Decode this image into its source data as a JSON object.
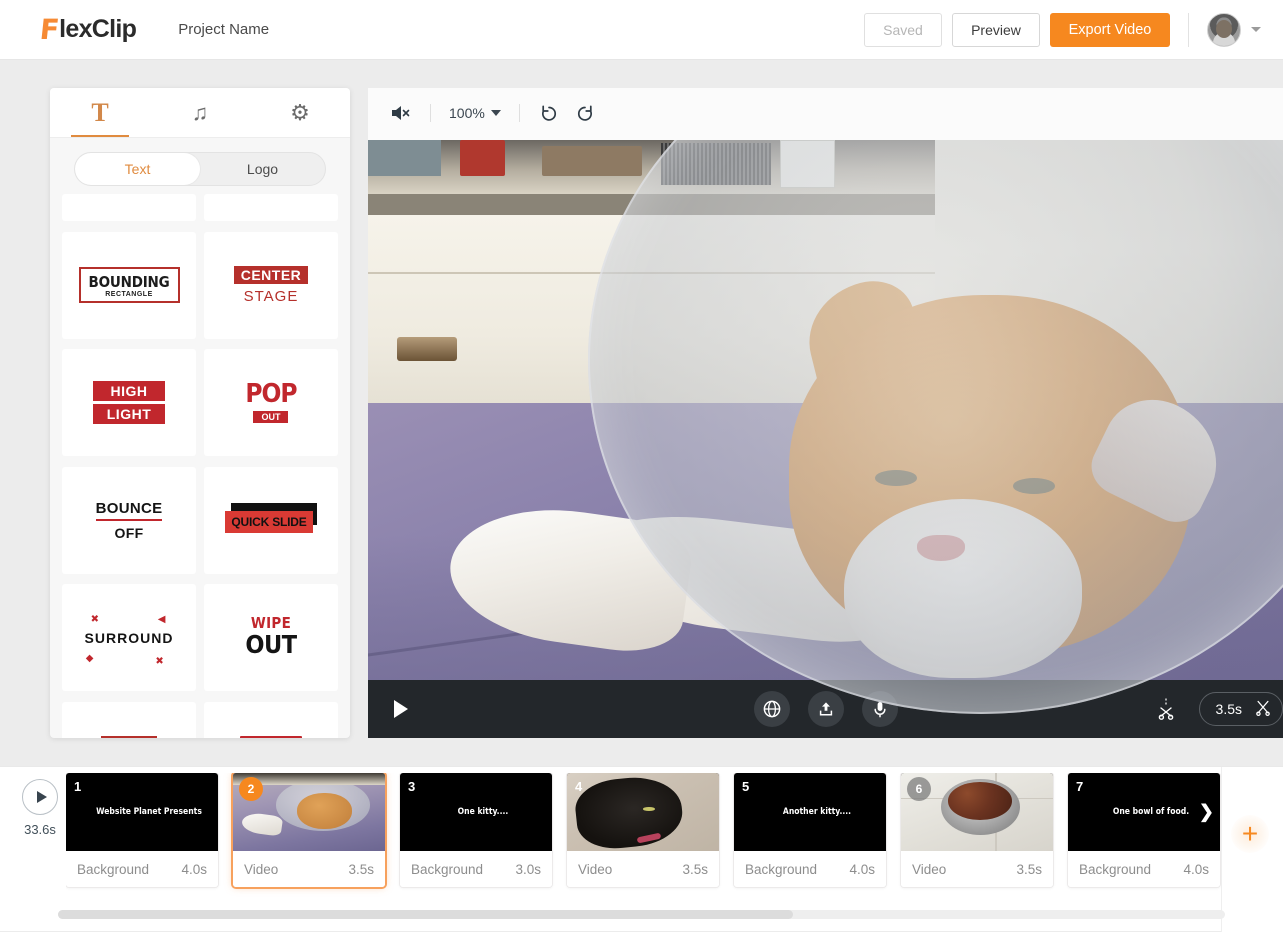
{
  "header": {
    "logo_f": "F",
    "logo_text": "lexClip",
    "project_name": "Project Name",
    "saved_label": "Saved",
    "preview_label": "Preview",
    "export_label": "Export Video"
  },
  "sidebar": {
    "tabs": [
      {
        "label": "T",
        "name": "text-tab",
        "active": true
      },
      {
        "label": "♫",
        "name": "music-tab",
        "active": false
      },
      {
        "label": "⚙",
        "name": "settings-tab",
        "active": false
      }
    ],
    "segments": [
      {
        "label": "Text",
        "active": true
      },
      {
        "label": "Logo",
        "active": false
      }
    ],
    "templates": [
      {
        "name": "bounding-rectangle",
        "line1": "BOUNDING",
        "line2": "RECTANGLE"
      },
      {
        "name": "center-stage",
        "line1": "CENTER",
        "line2": "STAGE"
      },
      {
        "name": "high-light",
        "line1": "HIGH",
        "line2": "LIGHT"
      },
      {
        "name": "pop-out",
        "line1": "POP",
        "line2": "OUT"
      },
      {
        "name": "bounce-off",
        "line1": "BOUNCE",
        "line2": "OFF"
      },
      {
        "name": "quick-slide",
        "line1": "QUICK SLIDE",
        "line2": ""
      },
      {
        "name": "surround",
        "line1": "SURROUND",
        "line2": ""
      },
      {
        "name": "wipe-out",
        "line1": "WIPE",
        "line2": "OUT"
      }
    ]
  },
  "preview": {
    "mute_icon": "speaker-mute-icon",
    "zoom_level": "100%",
    "undo_icon": "undo-icon",
    "redo_icon": "redo-icon",
    "player": {
      "play_icon": "play-icon",
      "center_buttons": [
        {
          "name": "globe-button",
          "glyph": "⊕"
        },
        {
          "name": "upload-button",
          "glyph": "⇧"
        },
        {
          "name": "microphone-button",
          "glyph": "⸬"
        }
      ],
      "split_icon": "scissors-split-icon",
      "duration": "3.5s",
      "trim_icon": "scissors-icon"
    }
  },
  "timeline": {
    "play_icon": "play-icon",
    "total_duration": "33.6s",
    "add_label": "+",
    "clips": [
      {
        "number": "1",
        "caption": "Website Planet Presents",
        "type": "Background",
        "duration": "4.0s",
        "thumb": "black",
        "badge": "plain",
        "selected": false
      },
      {
        "number": "2",
        "caption": "",
        "type": "Video",
        "duration": "3.5s",
        "thumb": "cat-cone",
        "badge": "orange",
        "selected": true
      },
      {
        "number": "3",
        "caption": "One kitty....",
        "type": "Background",
        "duration": "3.0s",
        "thumb": "black",
        "badge": "plain",
        "selected": false
      },
      {
        "number": "4",
        "caption": "",
        "type": "Video",
        "duration": "3.5s",
        "thumb": "black-cat",
        "badge": "plain",
        "selected": false
      },
      {
        "number": "5",
        "caption": "Another kitty....",
        "type": "Background",
        "duration": "4.0s",
        "thumb": "black",
        "badge": "plain",
        "selected": false
      },
      {
        "number": "6",
        "caption": "",
        "type": "Video",
        "duration": "3.5s",
        "thumb": "food-bowl",
        "badge": "grey",
        "selected": false
      },
      {
        "number": "7",
        "caption": "One bowl of food.",
        "type": "Background",
        "duration": "4.0s",
        "thumb": "black",
        "badge": "plain",
        "selected": false
      }
    ]
  },
  "colors": {
    "accent_orange": "#f6881f",
    "template_red": "#c1272d",
    "player_bar": "#23272b",
    "panel_bg": "#f7f7f7"
  }
}
